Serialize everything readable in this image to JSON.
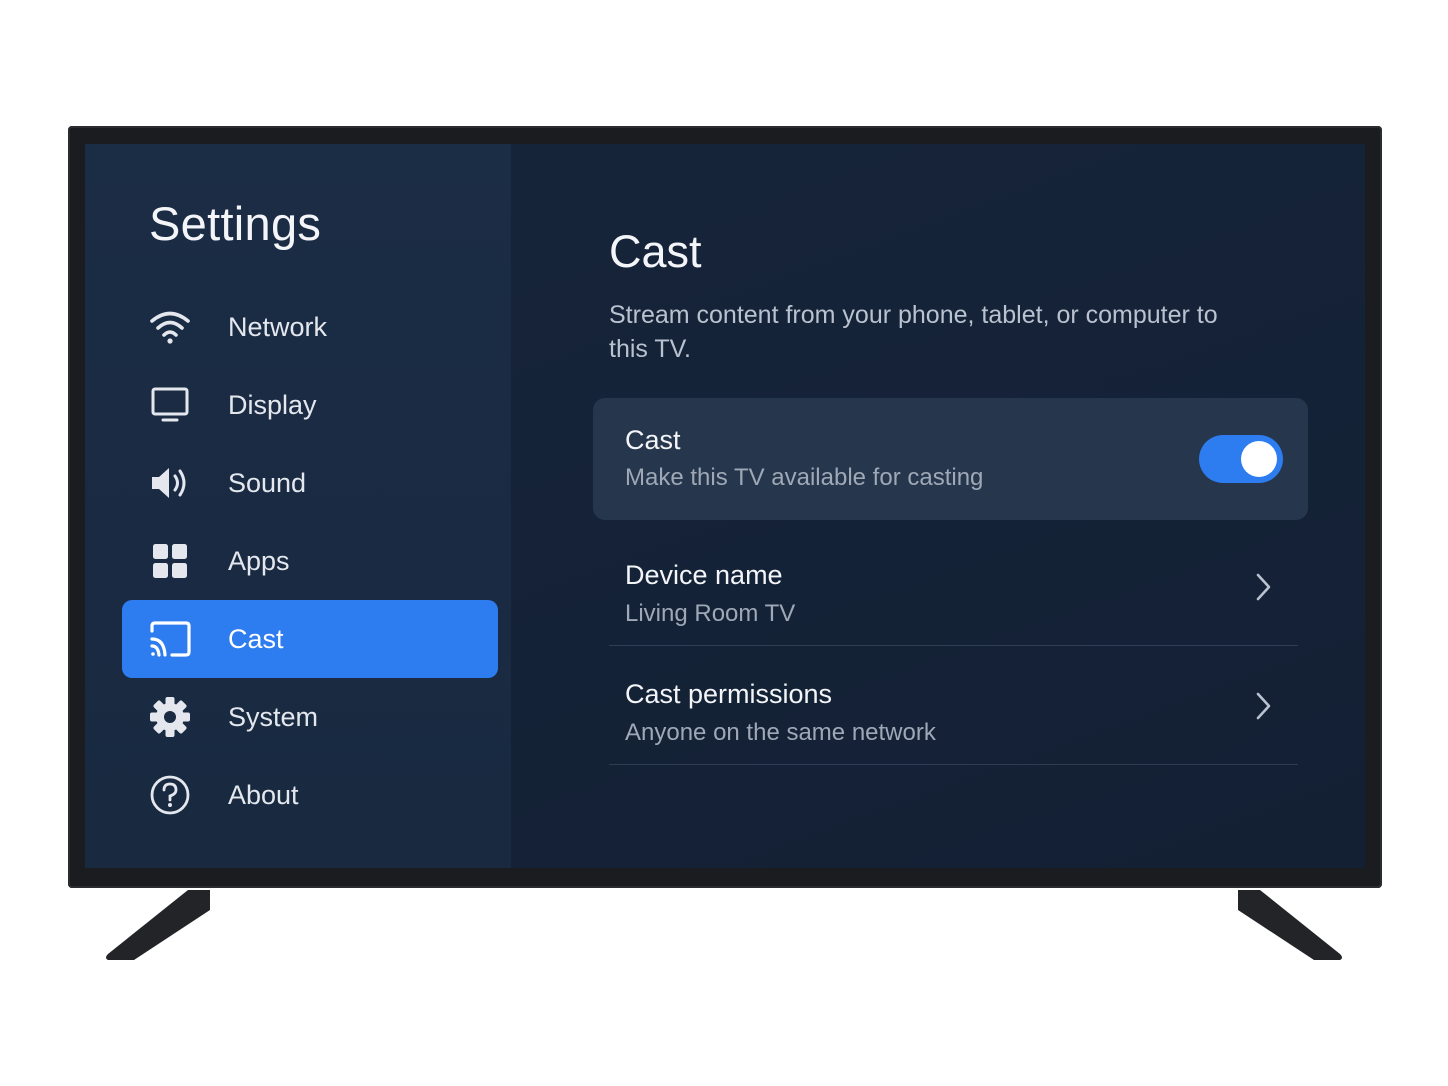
{
  "sidebar": {
    "title": "Settings",
    "items": [
      {
        "label": "Network",
        "icon": "wifi-icon"
      },
      {
        "label": "Display",
        "icon": "monitor-icon"
      },
      {
        "label": "Sound",
        "icon": "speaker-icon"
      },
      {
        "label": "Apps",
        "icon": "apps-grid-icon"
      },
      {
        "label": "Cast",
        "icon": "cast-icon",
        "selected": true
      },
      {
        "label": "System",
        "icon": "gear-icon"
      },
      {
        "label": "About",
        "icon": "help-circle-icon"
      }
    ]
  },
  "main": {
    "title": "Cast",
    "description": "Stream content from your phone, tablet, or computer to this TV.",
    "cast_toggle": {
      "title": "Cast",
      "subtitle": "Make this TV available for casting",
      "enabled": true
    },
    "device_name": {
      "title": "Device name",
      "value": "Living Room TV"
    },
    "cast_permissions": {
      "title": "Cast permissions",
      "value": "Anyone on the same network"
    }
  },
  "colors": {
    "accent": "#2d7cf0",
    "bezel": "#1b1c1f",
    "sidebar_bg": "#1b2c45",
    "content_bg": "#16243a",
    "highlight_row": "#26364d"
  }
}
